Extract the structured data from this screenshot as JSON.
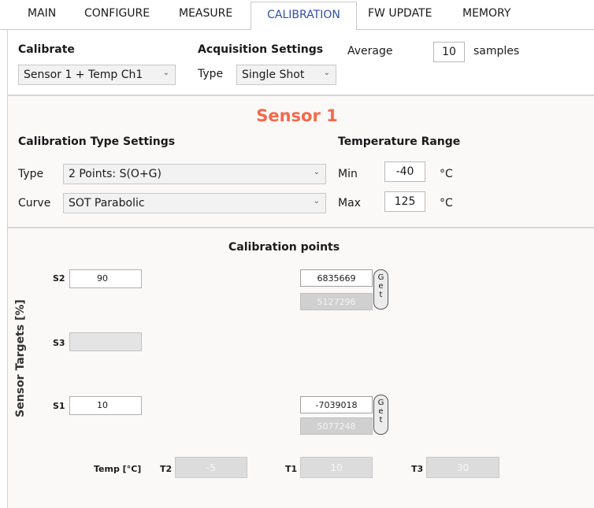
{
  "tabs": [
    "MAIN",
    "CONFIGURE",
    "MEASURE",
    "CALIBRATION",
    "FW UPDATE",
    "MEMORY"
  ],
  "calibrate": {
    "label": "Calibrate",
    "value": "Sensor 1 + Temp Ch1"
  },
  "acquisition": {
    "label": "Acquisition Settings",
    "type_label": "Type",
    "type_value": "Single Shot",
    "average_label": "Average",
    "average_value": "10",
    "samples_label": "samples"
  },
  "sensor_title": "Sensor 1",
  "cal_type": {
    "heading": "Calibration Type Settings",
    "type_label": "Type",
    "type_value": "2 Points: S(O+G)",
    "curve_label": "Curve",
    "curve_value": "SOT Parabolic"
  },
  "temp_range": {
    "heading": "Temperature Range",
    "min_label": "Min",
    "min_value": "-40",
    "max_label": "Max",
    "max_value": "125",
    "unit": "°C"
  },
  "points": {
    "heading": "Calibration points",
    "y_axis_label": "Sensor Targets [%]",
    "s2_label": "S2",
    "s2_value": "90",
    "s3_label": "S3",
    "s3_value": "",
    "s1_label": "S1",
    "s1_value": "10",
    "s2_raw_current": "6835669",
    "s2_raw_previous": "5127296",
    "s1_raw_current": "-7039018",
    "s1_raw_previous": "5077248",
    "get_label": [
      "G",
      "e",
      "t"
    ],
    "temp_label": "Temp [°C]",
    "t2_label": "T2",
    "t2_value": "-5",
    "t1_label": "T1",
    "t1_value": "10",
    "t3_label": "T3",
    "t3_value": "30"
  }
}
